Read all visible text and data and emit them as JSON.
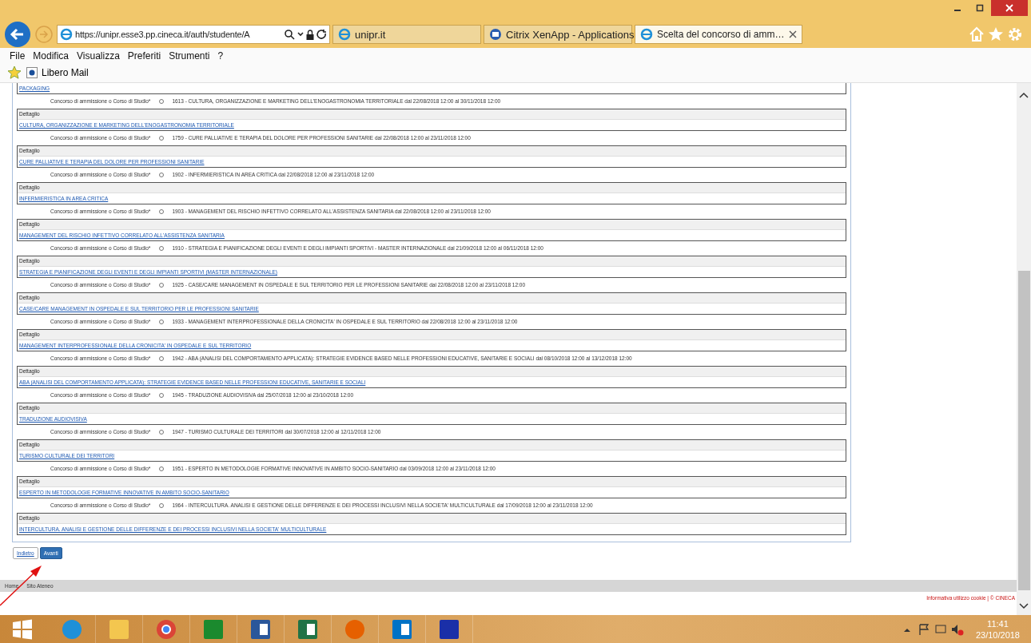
{
  "browser": {
    "address": "https://unipr.esse3.pp.cineca.it/auth/studente/A",
    "tabs": [
      {
        "label": "unipr.it",
        "selected": false,
        "kind": "ie"
      },
      {
        "label": "Citrix XenApp - Applications",
        "selected": false,
        "kind": "citrix"
      },
      {
        "label": "Scelta del concorso di amm…",
        "selected": true,
        "kind": "ie"
      }
    ],
    "menu": [
      "File",
      "Modifica",
      "Visualizza",
      "Preferiti",
      "Strumenti",
      "?"
    ],
    "favorites": [
      "Libero Mail"
    ]
  },
  "page": {
    "partial_link": "PACKAGING",
    "items": [
      {
        "label": "Concorso di ammissione o Corso di Studio*",
        "selected": false,
        "option": "1613 - CULTURA, ORGANIZZAZIONE E MARKETING DELL'ENOGASTRONOMIA TERRITORIALE dal 22/08/2018 12:00 al 30/11/2018 12:00",
        "detail": "Dettaglio",
        "link": "CULTURA, ORGANIZZAZIONE E MARKETING DELL'ENOGASTRONOMIA TERRITORIALE"
      },
      {
        "label": "Concorso di ammissione o Corso di Studio*",
        "selected": false,
        "option": "1759 - CURE PALLIATIVE E TERAPIA DEL DOLORE PER PROFESSIONI SANITARIE dal 22/08/2018 12:00 al 23/11/2018 12:00",
        "detail": "Dettaglio",
        "link": "CURE PALLIATIVE E TERAPIA DEL DOLORE PER PROFESSIONI SANITARIE"
      },
      {
        "label": "Concorso di ammissione o Corso di Studio*",
        "selected": false,
        "option": "1902 - INFERMIERISTICA IN AREA CRITICA dal 22/08/2018 12:00 al 23/11/2018 12:00",
        "detail": "Dettaglio",
        "link": "INFERMIERISTICA IN AREA CRITICA"
      },
      {
        "label": "Concorso di ammissione o Corso di Studio*",
        "selected": false,
        "option": "1903 - MANAGEMENT DEL RISCHIO INFETTIVO CORRELATO ALL'ASSISTENZA SANITARIA dal 22/08/2018 12:00 al 23/11/2018 12:00",
        "detail": "Dettaglio",
        "link": "MANAGEMENT DEL RISCHIO INFETTIVO CORRELATO ALL'ASSISTENZA SANITARIA"
      },
      {
        "label": "Concorso di ammissione o Corso di Studio*",
        "selected": false,
        "option": "1910 - STRATEGIA E PIANIFICAZIONE DEGLI EVENTI E DEGLI IMPIANTI SPORTIVI - MASTER INTERNAZIONALE dal 21/09/2018 12:00 al 06/11/2018 12:00",
        "detail": "Dettaglio",
        "link": "STRATEGIA E PIANIFICAZIONE DEGLI EVENTI E DEGLI IMPIANTI SPORTIVI (MASTER INTERNAZIONALE)"
      },
      {
        "label": "Concorso di ammissione o Corso di Studio*",
        "selected": false,
        "option": "1925 - CASE/CARE MANAGEMENT IN OSPEDALE E SUL TERRITORIO PER LE PROFESSIONI SANITARIE dal 22/08/2018 12:00 al 23/11/2018 12:00",
        "detail": "Dettaglio",
        "link": "CASE/CARE MANAGEMENT IN OSPEDALE E SUL TERRITORIO PER LE PROFESSIONI SANITARIE"
      },
      {
        "label": "Concorso di ammissione o Corso di Studio*",
        "selected": false,
        "option": "1933 - MANAGEMENT INTERPROFESSIONALE DELLA CRONICITA' IN OSPEDALE E SUL TERRITORIO dal 22/08/2018 12:00 al 23/11/2018 12:00",
        "detail": "Dettaglio",
        "link": "MANAGEMENT INTERPROFESSIONALE DELLA CRONICITA' IN OSPEDALE E SUL TERRITORIO"
      },
      {
        "label": "Concorso di ammissione o Corso di Studio*",
        "selected": false,
        "option": "1942 - ABA (ANALISI DEL COMPORTAMENTO APPLICATA): STRATEGIE EVIDENCE BASED NELLE PROFESSIONI EDUCATIVE, SANITARIE E SOCIALI dal 08/10/2018 12:00 al 13/12/2018 12:00",
        "detail": "Dettaglio",
        "link": "ABA (ANALISI DEL COMPORTAMENTO APPLICATA): STRATEGIE EVIDENCE BASED NELLE PROFESSIONI EDUCATIVE, SANITARIE E SOCIALI"
      },
      {
        "label": "Concorso di ammissione o Corso di Studio*",
        "selected": false,
        "option": "1945 - TRADUZIONE AUDIOVISIVA dal 25/07/2018 12:00 al 23/10/2018 12:00",
        "detail": "Dettaglio",
        "link": "TRADUZIONE AUDIOVISIVA"
      },
      {
        "label": "Concorso di ammissione o Corso di Studio*",
        "selected": false,
        "option": "1947 - TURISMO CULTURALE DEI TERRITORI dal 30/07/2018 12:00 al 12/11/2018 12:00",
        "detail": "Dettaglio",
        "link": "TURISMO CULTURALE DEI TERRITORI"
      },
      {
        "label": "Concorso di ammissione o Corso di Studio*",
        "selected": false,
        "option": "1951 - ESPERTO IN METODOLOGIE FORMATIVE INNOVATIVE IN AMBITO SOCIO-SANITARIO dal 03/09/2018 12:00 al 23/11/2018 12:00",
        "detail": "Dettaglio",
        "link": "ESPERTO IN METODOLOGIE FORMATIVE INNOVATIVE IN AMBITO SOCIO-SANITARIO"
      },
      {
        "label": "Concorso di ammissione o Corso di Studio*",
        "selected": false,
        "option": "1964 - INTERCULTURA. ANALISI E GESTIONE DELLE DIFFERENZE E DEI PROCESSI INCLUSIVI NELLA SOCIETA' MULTICULTURALE dal 17/09/2018 12:00 al 23/11/2018 12:00",
        "detail": "Dettaglio",
        "link": "INTERCULTURA. ANALISI E GESTIONE DELLE DIFFERENZE E DEI PROCESSI INCLUSIVI NELLA SOCIETA' MULTICULTURALE"
      }
    ],
    "back_button": "Indietro",
    "next_button": "Avanti",
    "footer_links": [
      "Home",
      "Sito Ateneo"
    ],
    "cookie_note": "Informativa utilizzo cookie | © CINECA"
  },
  "taskbar": {
    "apps": [
      {
        "kind": "ie"
      },
      {
        "kind": "folder"
      },
      {
        "kind": "chrome"
      },
      {
        "kind": "calculator"
      },
      {
        "kind": "word"
      },
      {
        "kind": "excel"
      },
      {
        "kind": "firefox"
      },
      {
        "kind": "outlook"
      },
      {
        "kind": "institution"
      }
    ],
    "time": "11:41",
    "date": "23/10/2018"
  }
}
